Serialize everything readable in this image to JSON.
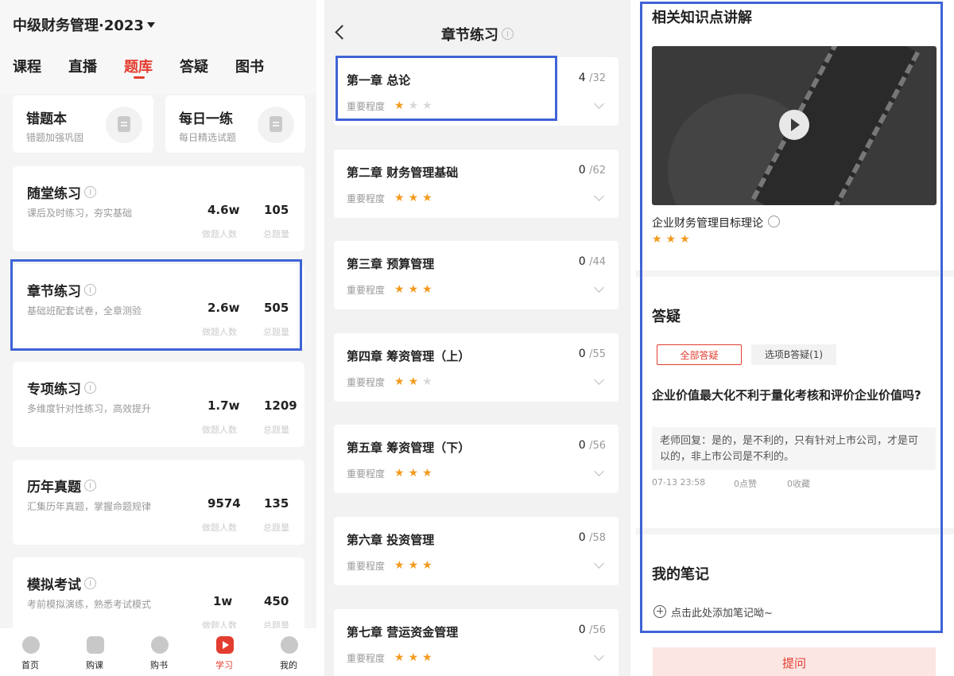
{
  "colors": {
    "accent": "#e33d2f",
    "highlight_box": "#3f63d6",
    "star": "#f39a1d"
  },
  "panel1": {
    "app_title": "中级财务管理·2023",
    "tabs": [
      {
        "label": "课程",
        "active": false
      },
      {
        "label": "直播",
        "active": false
      },
      {
        "label": "题库",
        "active": true
      },
      {
        "label": "答疑",
        "active": false
      },
      {
        "label": "图书",
        "active": false
      }
    ],
    "quick_cards": [
      {
        "title": "错题本",
        "subtitle": "错题加强巩固",
        "icon": "notebook-icon"
      },
      {
        "title": "每日一练",
        "subtitle": "每日精选试题",
        "icon": "calendar-icon"
      }
    ],
    "practice_cards": [
      {
        "title": "随堂练习",
        "desc": "课后及时练习，夯实基础",
        "users": "4.6w",
        "users_label": "做题人数",
        "total": "105",
        "total_label": "总题量"
      },
      {
        "title": "章节练习",
        "desc": "基础班配套试卷，全章测验",
        "users": "2.6w",
        "users_label": "做题人数",
        "total": "505",
        "total_label": "总题量"
      },
      {
        "title": "专项练习",
        "desc": "多维度针对性练习，高效提升",
        "users": "1.7w",
        "users_label": "做题人数",
        "total": "1209",
        "total_label": "总题量"
      },
      {
        "title": "历年真题",
        "desc": "汇集历年真题，掌握命题规律",
        "users": "9574",
        "users_label": "做题人数",
        "total": "135",
        "total_label": "总题量"
      },
      {
        "title": "模拟考试",
        "desc": "考前模拟演练，熟悉考试模式",
        "users": "1w",
        "users_label": "做题人数",
        "total": "450",
        "total_label": "总题量"
      }
    ],
    "bottom_nav": [
      {
        "label": "首页",
        "icon": "home-icon",
        "active": false
      },
      {
        "label": "购课",
        "icon": "bag-icon",
        "active": false
      },
      {
        "label": "购书",
        "icon": "compass-icon",
        "active": false
      },
      {
        "label": "学习",
        "icon": "play-icon",
        "active": true
      },
      {
        "label": "我的",
        "icon": "profile-icon",
        "active": false
      }
    ]
  },
  "panel2": {
    "title": "章节练习",
    "importance_label": "重要程度",
    "chapters": [
      {
        "title": "第一章  总论",
        "done": "4",
        "total": "/32",
        "stars": 1
      },
      {
        "title": "第二章  财务管理基础",
        "done": "0",
        "total": "/62",
        "stars": 3
      },
      {
        "title": "第三章  预算管理",
        "done": "0",
        "total": "/44",
        "stars": 3
      },
      {
        "title": "第四章  筹资管理（上）",
        "done": "0",
        "total": "/55",
        "stars": 2
      },
      {
        "title": "第五章  筹资管理（下）",
        "done": "0",
        "total": "/56",
        "stars": 3
      },
      {
        "title": "第六章  投资管理",
        "done": "0",
        "total": "/58",
        "stars": 3
      },
      {
        "title": "第七章  营运资金管理",
        "done": "0",
        "total": "/56",
        "stars": 3
      }
    ]
  },
  "panel3": {
    "knowledge_title": "相关知识点讲解",
    "knowledge_name": "企业财务管理目标理论",
    "knowledge_stars": 3,
    "qa_title": "答疑",
    "filter_tabs": [
      {
        "label": "全部答疑",
        "active": true
      },
      {
        "label": "选项B答疑(1)",
        "active": false
      }
    ],
    "question": "企业价值最大化不利于量化考核和评价企业价值吗?",
    "reply": "老师回复：是的，是不利的，只有针对上市公司，才是可以的，非上市公司是不利的。",
    "time": "07-13 23:58",
    "likes": "0点赞",
    "favorites": "0收藏",
    "notes_title": "我的笔记",
    "add_note": "点击此处添加笔记呦~",
    "ask_button": "提问"
  }
}
